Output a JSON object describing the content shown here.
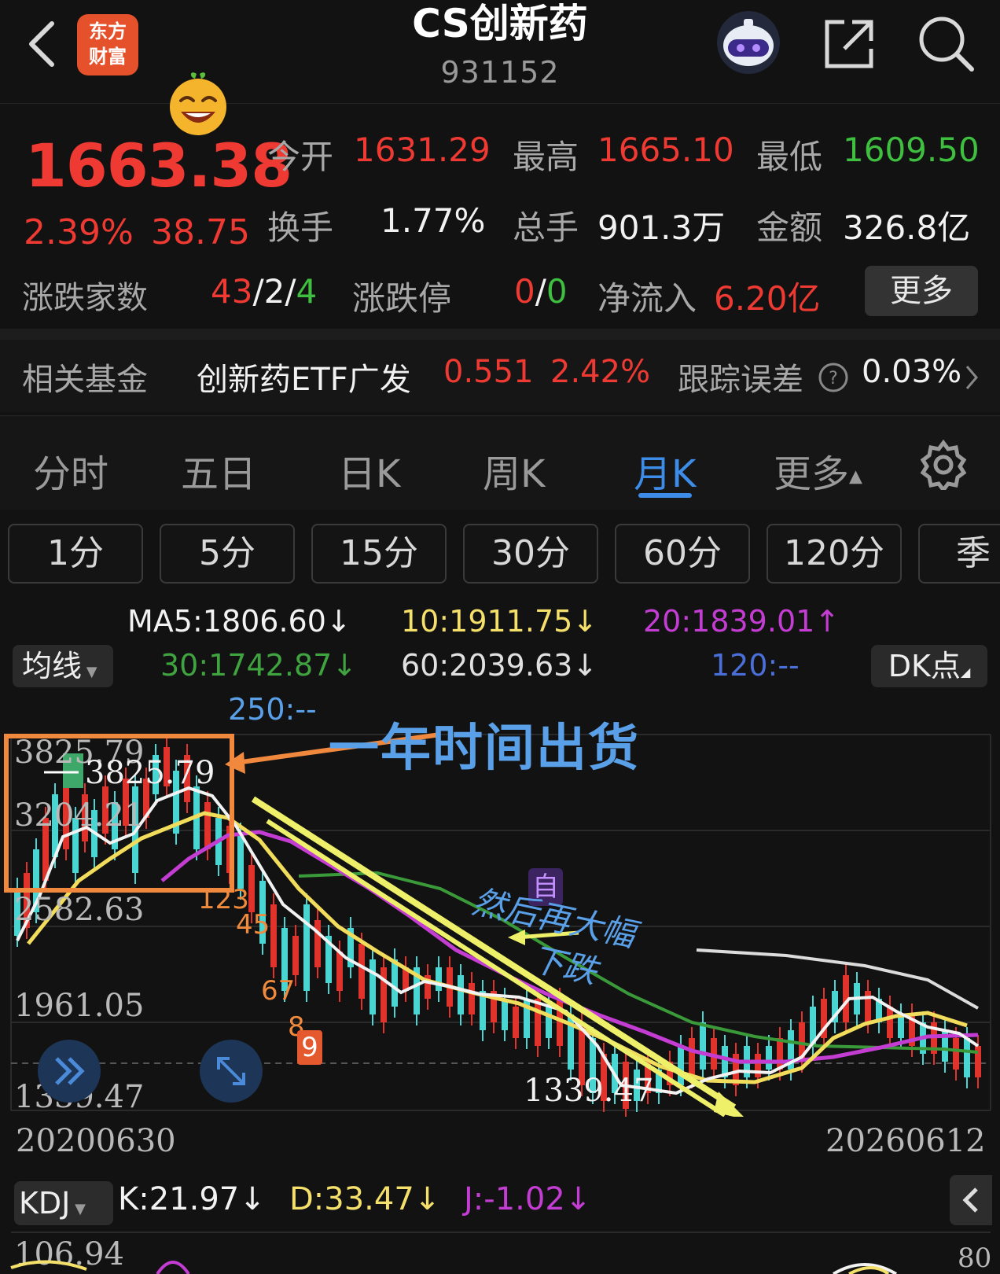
{
  "header": {
    "back_icon": "chevron-left-icon",
    "logo_text_line1": "东方",
    "logo_text_line2": "财富",
    "title": "CS创新药",
    "code": "931152",
    "robot_icon": "assistant-robot-icon",
    "share_icon": "share-icon",
    "search_icon": "search-icon"
  },
  "quote": {
    "price": "1663.38",
    "change_pct": "2.39%",
    "change_amt": "38.75",
    "open_label": "今开",
    "open": "1631.29",
    "high_label": "最高",
    "high": "1665.10",
    "low_label": "最低",
    "low": "1609.50",
    "turnover_label": "换手",
    "turnover": "1.77%",
    "volume_label": "总手",
    "volume": "901.3万",
    "amount_label": "金额",
    "amount": "326.8亿",
    "breadth_label": "涨跌家数",
    "breadth_up": "43",
    "breadth_flat": "2",
    "breadth_down": "4",
    "limit_label": "涨跌停",
    "limit_up": "0",
    "limit_down": "0",
    "inflow_label": "净流入",
    "inflow": "6.20亿",
    "more_label": "更多"
  },
  "fund": {
    "label": "相关基金",
    "name": "创新药ETF广发",
    "price": "0.551",
    "pct": "2.42%",
    "tracking_label": "跟踪误差",
    "tracking_value": "0.03%"
  },
  "period_tabs": [
    "分时",
    "五日",
    "日K",
    "周K",
    "月K",
    "更多"
  ],
  "active_period": "月K",
  "minute_buttons": [
    "1分",
    "5分",
    "15分",
    "30分",
    "60分",
    "120分",
    "季K"
  ],
  "ma": {
    "ma5": "MA5:1806.60",
    "ma10": "10:1911.75",
    "ma20": "20:1839.01",
    "ma30": "30:1742.87",
    "ma60": "60:2039.63",
    "ma120": "120:--",
    "ma250": "250:--",
    "ma_select": "均线",
    "dk_label": "DK点",
    "colors": {
      "ma5": "#f2f2f2",
      "ma10": "#f4e06a",
      "ma20": "#c43dd3",
      "ma30": "#3fa33f",
      "ma60": "#e0e0e0",
      "ma120": "#4b6fd8",
      "ma250": "#5aa0e8"
    }
  },
  "chart": {
    "y_labels": [
      "3825.79",
      "3204.21",
      "2582.63",
      "1961.05",
      "1339.47"
    ],
    "x_start": "20200630",
    "x_end": "20260612",
    "high_marker": "3825.79",
    "low_marker": "1339.47",
    "annotation_main": "一年时间出货",
    "annotation_2_line1": "然后再大幅",
    "annotation_2_line2": "下跌",
    "zi_badge": "自",
    "nine_seq": [
      "1",
      "2",
      "3",
      "4",
      "5",
      "6",
      "7",
      "8",
      "9"
    ],
    "nine_badge": "9"
  },
  "kdj": {
    "select": "KDJ",
    "k": "K:21.97",
    "d": "D:33.47",
    "j": "J:-1.02",
    "y_top": "106.94",
    "y_right": "80"
  }
}
